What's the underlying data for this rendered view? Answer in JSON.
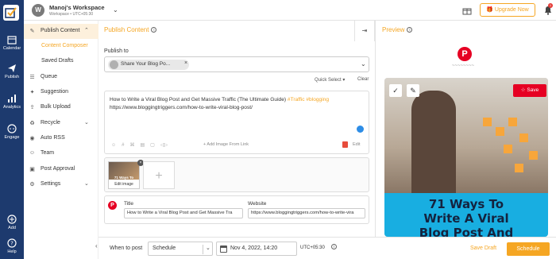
{
  "rail": {
    "items": [
      {
        "label": "Calendar",
        "icon": "calendar-icon"
      },
      {
        "label": "Publish",
        "icon": "send-icon"
      },
      {
        "label": "Analytics",
        "icon": "analytics-icon"
      },
      {
        "label": "Engage",
        "icon": "chat-icon"
      }
    ],
    "bottom": [
      {
        "label": "Add",
        "icon": "plus-circle-icon"
      },
      {
        "label": "Help",
        "icon": "help-icon"
      }
    ]
  },
  "topbar": {
    "workspace_initial": "W",
    "workspace_name": "Manoj's Workspace",
    "workspace_sub": "Workspace • UTC+05:30",
    "upgrade_label": "Upgrade Now",
    "notif_count": "1"
  },
  "sidenav": {
    "publish_content": "Publish Content",
    "content_composer": "Content Composer",
    "saved_drafts": "Saved Drafts",
    "items": [
      "Queue",
      "Suggestion",
      "Bulk Upload",
      "Recycle",
      "Auto RSS",
      "Team",
      "Post Approval",
      "Settings"
    ]
  },
  "composer": {
    "title": "Publish Content",
    "publish_to": "Publish to",
    "account_chip": "Share Your Blog Po...",
    "quick_select": "Quick Select ▾",
    "clear": "Clear",
    "post_text": "How to Write a Viral Blog Post and Get Massive Traffic (The Ultimate Guide)",
    "tag1": "#Traffic",
    "tag2": "#blogging",
    "post_link": "https://www.bloggingtriggers.com/how-to-write-viral-blog-post/",
    "add_image_link": "+ Add Image From Link",
    "edit": "Edit",
    "thumb_caption": "71 Ways To",
    "thumb_edit": "Edit image",
    "pin_title_label": "Title",
    "pin_title_value": "How to Write a Viral Blog Post and Get Massive Tra",
    "pin_website_label": "Website",
    "pin_website_value": "https://www.bloggingtriggers.com/how-to-write-vira"
  },
  "preview": {
    "title": "Preview",
    "save_label": "Save",
    "headline_1": "71 Ways To",
    "headline_2": "Write A Viral",
    "headline_3": "Blog Post And"
  },
  "bottombar": {
    "when_to_post": "When to post",
    "schedule_option": "Schedule",
    "date_value": "Nov 4, 2022, 14:20",
    "timezone": "UTC+05:30",
    "save_draft": "Save Draft",
    "schedule_button": "Schedule"
  },
  "colors": {
    "accent": "#f5a623",
    "rail": "#1d3a6e",
    "pinterest": "#e60023",
    "preview_band": "#18aee1"
  }
}
